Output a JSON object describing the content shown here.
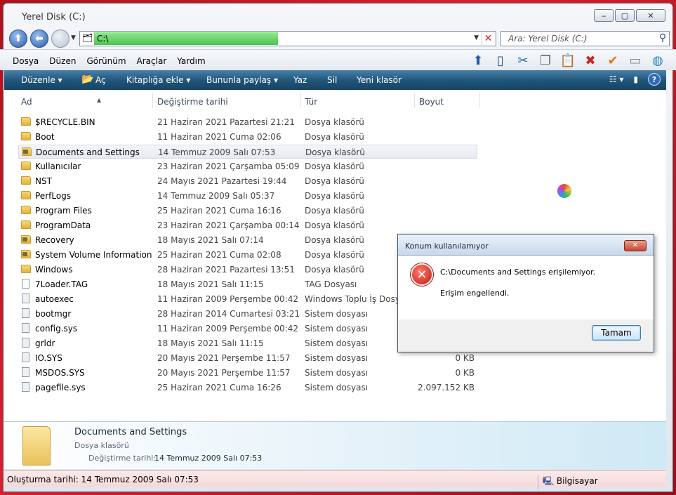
{
  "window": {
    "title": "Yerel Disk (C:)",
    "minimize": "‒",
    "maximize": "▢",
    "close": "✕"
  },
  "nav": {
    "up": "⬆",
    "back": "⬅",
    "forward": ""
  },
  "address": {
    "path": "C:\\"
  },
  "search": {
    "placeholder": "Ara: Yerel Disk (C:)"
  },
  "menu": [
    "Dosya",
    "Düzen",
    "Görünüm",
    "Araçlar",
    "Yardım"
  ],
  "commands": {
    "organize": "Düzenle ▾",
    "open": "Aç",
    "library": "Kitaplığa ekle ▾",
    "share": "Bununla paylaş ▾",
    "burn": "Yaz",
    "delete": "Sil",
    "new_folder": "Yeni klasör"
  },
  "columns": {
    "name": "Ad",
    "date": "Değiştirme tarihi",
    "type": "Tür",
    "size": "Boyut"
  },
  "files": [
    {
      "name": "$RECYCLE.BIN",
      "date": "21 Haziran 2021 Pazartesi 21:21",
      "type": "Dosya klasörü",
      "size": "",
      "kind": "folder"
    },
    {
      "name": "Boot",
      "date": "11 Haziran 2021 Cuma 02:06",
      "type": "Dosya klasörü",
      "size": "",
      "kind": "folder"
    },
    {
      "name": "Documents and Settings",
      "date": "14 Temmuz 2009 Salı 07:53",
      "type": "Dosya klasörü",
      "size": "",
      "kind": "lockfolder"
    },
    {
      "name": "Kullanıcılar",
      "date": "23 Haziran 2021 Çarşamba 05:09",
      "type": "Dosya klasörü",
      "size": "",
      "kind": "folder"
    },
    {
      "name": "NST",
      "date": "24 Mayıs 2021 Pazartesi 19:44",
      "type": "Dosya klasörü",
      "size": "",
      "kind": "folder"
    },
    {
      "name": "PerfLogs",
      "date": "14 Temmuz 2009 Salı 05:37",
      "type": "Dosya klasörü",
      "size": "",
      "kind": "folder"
    },
    {
      "name": "Program Files",
      "date": "25 Haziran 2021 Cuma 16:16",
      "type": "Dosya klasörü",
      "size": "",
      "kind": "folder"
    },
    {
      "name": "ProgramData",
      "date": "23 Haziran 2021 Çarşamba 00:14",
      "type": "Dosya klasörü",
      "size": "",
      "kind": "folder"
    },
    {
      "name": "Recovery",
      "date": "18 Mayıs 2021 Salı 07:14",
      "type": "Dosya klasörü",
      "size": "",
      "kind": "lockfolder"
    },
    {
      "name": "System Volume Information",
      "date": "25 Haziran 2021 Cuma 02:08",
      "type": "Dosya klasörü",
      "size": "",
      "kind": "lockfolder"
    },
    {
      "name": "Windows",
      "date": "28 Haziran 2021 Pazartesi 13:51",
      "type": "Dosya klasörü",
      "size": "",
      "kind": "folder"
    },
    {
      "name": "7Loader.TAG",
      "date": "18 Mayıs 2021 Salı 11:15",
      "type": "TAG Dosyası",
      "size": "",
      "kind": "file"
    },
    {
      "name": "autoexec",
      "date": "11 Haziran 2009 Perşembe 00:42",
      "type": "Windows Toplu İş Dosyası",
      "size": "",
      "kind": "sys"
    },
    {
      "name": "bootmgr",
      "date": "28 Haziran 2014 Cumartesi 03:21",
      "type": "Sistem dosyası",
      "size": "",
      "kind": "sys"
    },
    {
      "name": "config.sys",
      "date": "11 Haziran 2009 Perşembe 00:42",
      "type": "Sistem dosyası",
      "size": "",
      "kind": "sys"
    },
    {
      "name": "grldr",
      "date": "18 Mayıs 2021 Salı 11:15",
      "type": "Sistem dosyası",
      "size": "",
      "kind": "sys"
    },
    {
      "name": "IO.SYS",
      "date": "20 Mayıs 2021 Perşembe 11:57",
      "type": "Sistem dosyası",
      "size": "0 KB",
      "kind": "sys"
    },
    {
      "name": "MSDOS.SYS",
      "date": "20 Mayıs 2021 Perşembe 11:57",
      "type": "Sistem dosyası",
      "size": "0 KB",
      "kind": "sys"
    },
    {
      "name": "pagefile.sys",
      "date": "25 Haziran 2021 Cuma 16:26",
      "type": "Sistem dosyası",
      "size": "2.097.152 KB",
      "kind": "sys"
    }
  ],
  "selected_index": 2,
  "details": {
    "name": "Documents and Settings",
    "type": "Dosya klasörü",
    "modified_label": "Değiştirme tarihi:",
    "modified_value": "14 Temmuz 2009 Salı 07:53"
  },
  "status": {
    "left": "Oluşturma tarihi: 14 Temmuz 2009 Salı 07:53",
    "right": "Bilgisayar"
  },
  "dialog": {
    "title": "Konum kullanılamıyor",
    "message": "C:\\Documents and Settings erişilemiyor.",
    "detail": "Erişim engellendi.",
    "ok": "Tamam"
  },
  "colors": {
    "accent": "#1f5479",
    "error": "#c41a10",
    "folder": "#e2b43a"
  }
}
